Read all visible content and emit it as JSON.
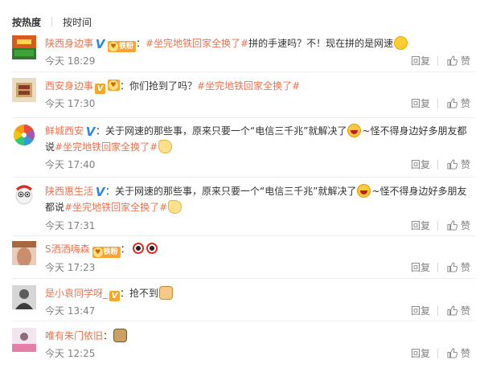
{
  "sort": {
    "hot": "按热度",
    "time": "按时间"
  },
  "actions": {
    "reply": "回复",
    "like": "赞"
  },
  "colors": {
    "username": "#eb7350",
    "time": "#808080",
    "topic": "#eb7350"
  },
  "comments": [
    {
      "user": "陕西身边事",
      "verify": "blue-v",
      "fan_badge": "铁粉",
      "sep": "：",
      "parts": [
        "#坐完地铁回家全换了#",
        "拼的手速吗？不！现在拼的是网速"
      ],
      "emojis": [
        "wink-emoji"
      ],
      "time": "今天 18:29"
    },
    {
      "user": "西安身边事",
      "verify": "gold-v",
      "fan_badge": "",
      "sep": "：",
      "parts": [
        "你们抢到了吗？",
        "#坐完地铁回家全换了#"
      ],
      "emojis": [],
      "time": "今天 17:30"
    },
    {
      "user": "鲜城西安",
      "verify": "blue-v",
      "sep": "：",
      "parts": [
        "关于网速的那些事，原来只要一个“电信三千兆”就解决了",
        "~怪不得身边好多朋友都说",
        "#坐完地铁回家全换了#"
      ],
      "emojis": [
        "laugh-emoji",
        "hand-emoji"
      ],
      "time": "今天 17:40"
    },
    {
      "user": "陕西惠生活",
      "verify": "blue-v",
      "sep": "：",
      "parts": [
        "关于网速的那些事，原来只要一个“电信三千兆”就解决了",
        "~怪不得身边好多朋友都说",
        "#坐完地铁回家全换了#"
      ],
      "emojis": [
        "laugh-emoji",
        "hand-emoji"
      ],
      "time": "今天 17:31"
    },
    {
      "user": "S洒洒嗨森",
      "fan_badge": "铁粉",
      "sep": "：",
      "parts": [],
      "emojis": [
        "eyes-emoji"
      ],
      "time": "今天 17:23"
    },
    {
      "user": "是小袁同学呀_",
      "verify": "gold-v",
      "sep": "：",
      "parts": [
        "抢不到"
      ],
      "emojis": [
        "cat-emoji"
      ],
      "time": "今天 13:47"
    },
    {
      "user": "唯有朱门依旧",
      "sep": "：",
      "parts": [],
      "emojis": [
        "dog-emoji"
      ],
      "time": "今天 12:25"
    }
  ]
}
